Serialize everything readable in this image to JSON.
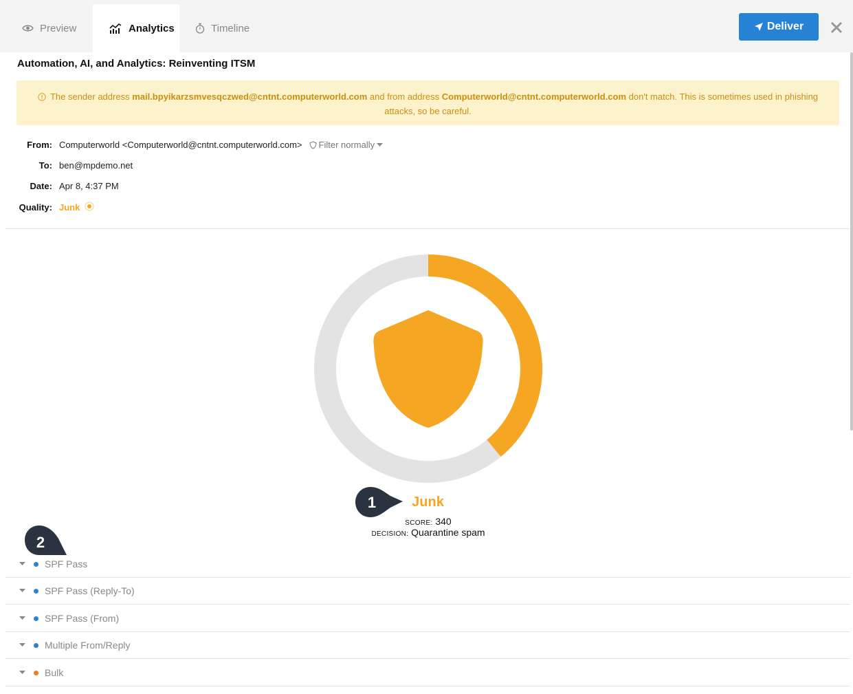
{
  "tabs": [
    {
      "label": "Preview",
      "icon": "eye-icon"
    },
    {
      "label": "Analytics",
      "icon": "analytics-icon"
    },
    {
      "label": "Timeline",
      "icon": "stopwatch-icon"
    }
  ],
  "toolbar": {
    "deliver_label": "Deliver",
    "close_icon": "close-icon"
  },
  "email": {
    "subject": "Automation, AI, and Analytics: Reinventing ITSM",
    "warning": {
      "prefix": "The sender address ",
      "sender": "mail.bpyikarzsmvesqczwed@cntnt.computerworld.com",
      "middle": " and from address ",
      "from_address": "Computerworld@cntnt.computerworld.com",
      "suffix": " don't match. This is sometimes used in phishing attacks, so be careful."
    },
    "from_label": "From:",
    "from": "Computerworld <Computerworld@cntnt.computerworld.com>",
    "filter_label": "Filter normally",
    "to_label": "To:",
    "to": "ben@mpdemo.net",
    "date_label": "Date:",
    "date": "Apr 8, 4:37 PM",
    "quality_label": "Quality:",
    "quality": "Junk"
  },
  "analysis": {
    "verdict": "Junk",
    "score_label": "SCORE:",
    "score": "340",
    "decision_label": "DECISION:",
    "decision": "Quarantine spam",
    "gauge_fraction": 0.39,
    "callouts": [
      "1",
      "2"
    ]
  },
  "rules": [
    {
      "label": "SPF Pass",
      "color": "#2b82d4"
    },
    {
      "label": "SPF Pass (Reply-To)",
      "color": "#2b82d4"
    },
    {
      "label": "SPF Pass (From)",
      "color": "#2b82d4"
    },
    {
      "label": "Multiple From/Reply",
      "color": "#2b82d4"
    },
    {
      "label": "Bulk",
      "color": "#f07d1f"
    }
  ],
  "colors": {
    "accent": "#f5a623",
    "primary": "#2582d4",
    "ring_bg": "#e3e3e3"
  }
}
